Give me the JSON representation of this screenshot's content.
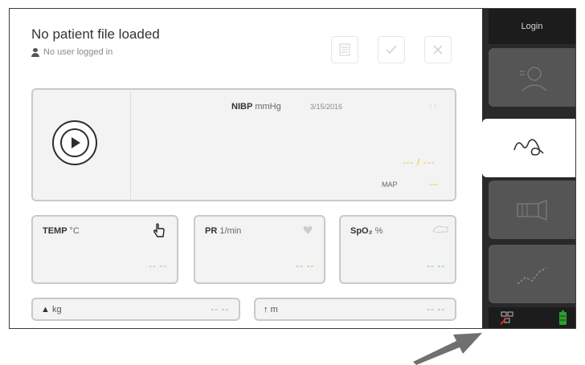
{
  "header": {
    "title": "No patient file loaded",
    "user_status": "No user logged in",
    "buttons": [
      {
        "name": "list-button",
        "icon": "list-icon"
      },
      {
        "name": "confirm-button",
        "icon": "check-icon"
      },
      {
        "name": "close-button",
        "icon": "close-icon"
      }
    ]
  },
  "nibp": {
    "label": "NIBP",
    "unit": "mmHg",
    "timestamp": "3/15/2016",
    "value": "--- / ---",
    "map_label": "MAP",
    "map_value": "---",
    "value_color": "#e8c000"
  },
  "vitals": [
    {
      "label": "TEMP",
      "unit": "°C",
      "value": "-- --",
      "value_color": "#aaaaaa",
      "icon": "hand-pointer-icon"
    },
    {
      "label": "PR",
      "unit": "1/min",
      "value": "-- --",
      "value_color": "#7fc93a",
      "icon": "heart-icon"
    },
    {
      "label": "SpO₂",
      "unit": "%",
      "value": "-- --",
      "value_color": "#48b8e8",
      "icon": "pulse-ox-icon"
    }
  ],
  "fields": {
    "weight_unit": "kg",
    "weight_value": "-- --",
    "height_unit": "m",
    "height_value": "-- --"
  },
  "sidebar": {
    "login_label": "Login",
    "tabs": [
      "patient-tab",
      "monitor-tab",
      "protocol-tab",
      "trend-tab"
    ],
    "active_tab": "monitor-tab"
  },
  "colors": {
    "sidebar_bg": "#292929",
    "tab_bg": "#555555",
    "battery": "#2e9e2e",
    "network_alert": "#d42a2a"
  }
}
